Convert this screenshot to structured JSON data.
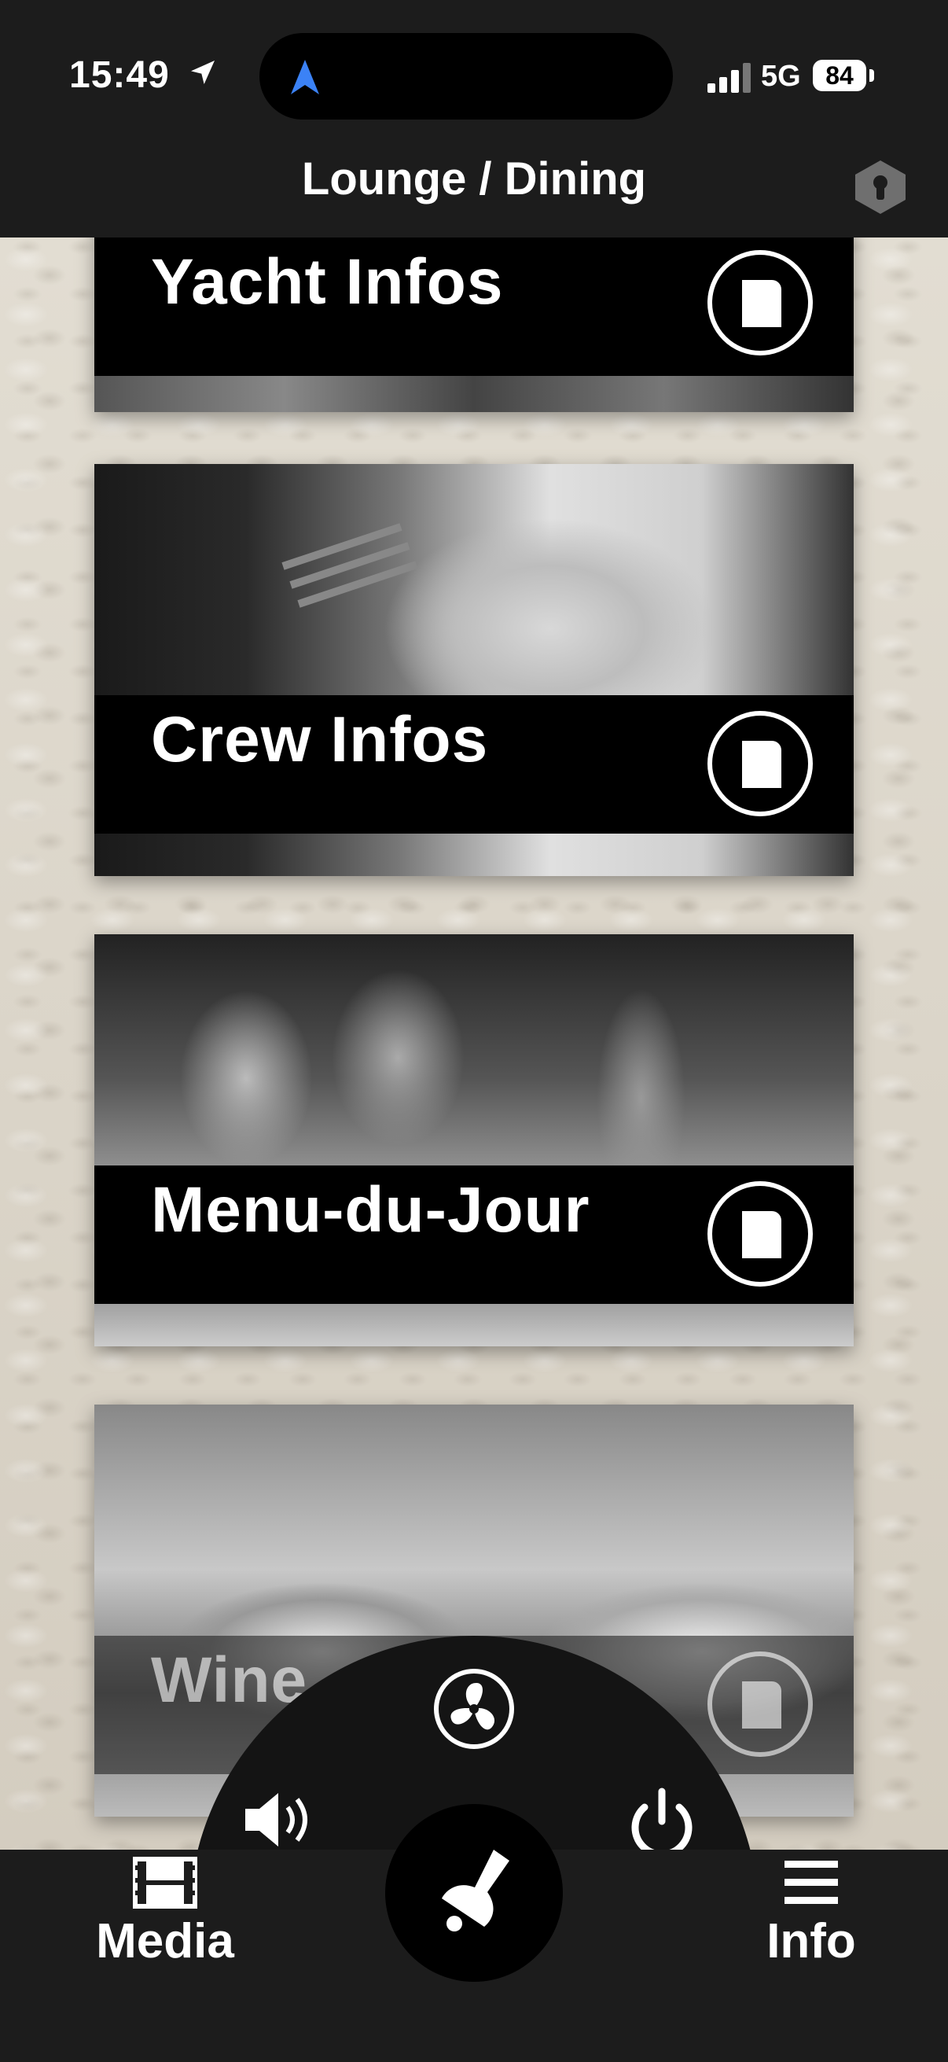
{
  "status": {
    "time": "15:49",
    "network": "5G",
    "battery": "84"
  },
  "nav": {
    "title": "Lounge / Dining"
  },
  "cards": [
    {
      "label": "Yacht Infos"
    },
    {
      "label": "Crew Infos"
    },
    {
      "label": "Menu-du-Jour"
    },
    {
      "label": "Wine"
    }
  ],
  "controls": {
    "icons": [
      "fan-icon",
      "volume-icon",
      "power-icon",
      "bell-icon"
    ]
  },
  "tabs": [
    {
      "label": "Media",
      "icon": "film-icon"
    },
    {
      "label": "Info",
      "icon": "menu-icon"
    }
  ],
  "colors": {
    "background": "#1c1c1c",
    "accent_glow": "#b46e28",
    "nav_arrow": "#3b82f6"
  }
}
